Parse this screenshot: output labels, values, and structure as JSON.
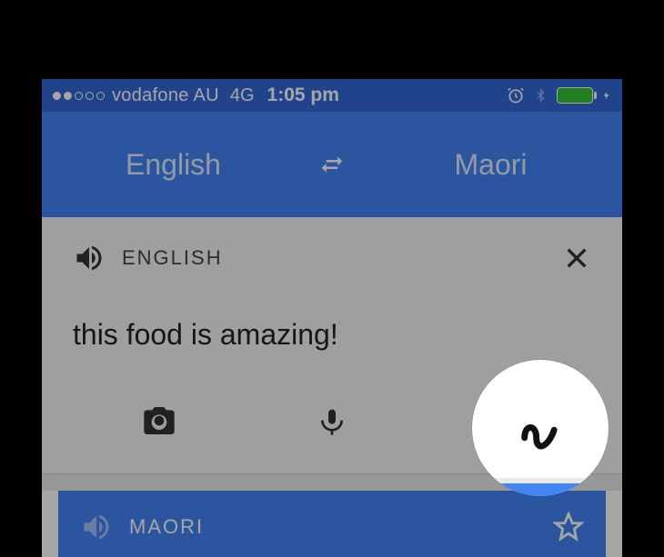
{
  "status_bar": {
    "carrier": "vodafone AU",
    "network": "4G",
    "time": "1:05 pm"
  },
  "lang_bar": {
    "source": "English",
    "target": "Maori"
  },
  "input_card": {
    "lang_label": "ENGLISH",
    "text": "this food is amazing!"
  },
  "result_card": {
    "lang_label": "MAORI"
  }
}
